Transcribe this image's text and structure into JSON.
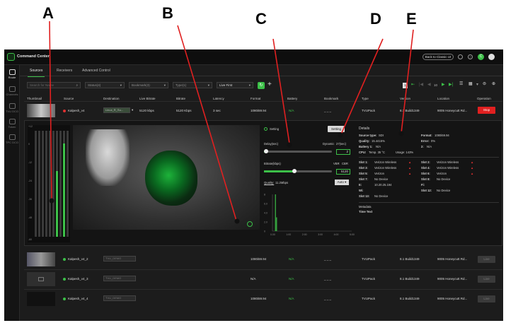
{
  "callouts": [
    "A",
    "B",
    "C",
    "D",
    "E"
  ],
  "app": {
    "title": "Command Center",
    "classic_button": "Back to Classic UI",
    "avatar_initial": "C"
  },
  "sidebar": {
    "items": [
      {
        "label": "Route",
        "icon": "route-icon"
      },
      {
        "label": "Channels",
        "icon": "channels-icon"
      },
      {
        "label": "TVU DCO",
        "icon": "tvu-dco-icon"
      },
      {
        "label": "Token",
        "icon": "token-icon"
      },
      {
        "label": "TPC DCO",
        "icon": "tpc-dco-icon"
      }
    ]
  },
  "tabs": [
    "Sources",
    "Receivers",
    "Advanced Control"
  ],
  "filters": {
    "search_placeholder": "Search for Name",
    "status": "Status(4)",
    "bookmark": "Bookmark(3)",
    "type": "Type(1)",
    "sort": "Live First"
  },
  "pagination": {
    "page": "1",
    "per_page": "10"
  },
  "columns": [
    "Thumbnail",
    "Source",
    "Destination",
    "Live Bitrate",
    "Bitrate",
    "Latency",
    "Format",
    "Battery",
    "Bookmark",
    "Type",
    "Version",
    "Location",
    "Operation"
  ],
  "rows": [
    {
      "source": "Kalpesh_v4",
      "status_color": "#e03030",
      "destination": "Linux_R_Su...",
      "live_bitrate": "5120 kbps",
      "bitrate": "5120 Kbps",
      "latency": "3 sec",
      "format": "1080i59.94",
      "battery": "N/A",
      "bookmark": "_ _ _",
      "type": "TVUPack",
      "version": "8.1 Build1349",
      "location": "9005 Honeycutt Rd...",
      "operation": "Stop"
    },
    {
      "source": "Kalpesh_v4_2",
      "status_color": "#3cc048",
      "destination": "TVU_DEMO",
      "live_bitrate": "",
      "bitrate": "",
      "latency": "",
      "format": "1080i59.94",
      "battery": "N/A",
      "bookmark": "_ _ _",
      "type": "TVUPack",
      "version": "8.1 Build1349",
      "location": "9005 Honeycutt Rd...",
      "operation": "Live"
    },
    {
      "source": "Kalpesh_v4_3",
      "status_color": "#3cc048",
      "destination": "TVU_DEMO",
      "live_bitrate": "",
      "bitrate": "",
      "latency": "",
      "format": "N/A",
      "battery": "N/A",
      "bookmark": "_ _ _",
      "type": "TVUPack",
      "version": "8.1 Build1349",
      "location": "9005 Honeycutt Rd...",
      "operation": "Live"
    },
    {
      "source": "Kalpesh_v4_4",
      "status_color": "#3cc048",
      "destination": "TVU_DEMO",
      "live_bitrate": "",
      "bitrate": "",
      "latency": "",
      "format": "1080i59.94",
      "battery": "N/A",
      "bookmark": "_ _ _",
      "type": "TVUPack",
      "version": "8.1 Build1349",
      "location": "9005 Honeycutt Rd...",
      "operation": "Live"
    }
  ],
  "audio_meter": {
    "scale": [
      "+12",
      "0",
      "-12",
      "-24",
      "-36",
      "-48",
      "-60"
    ],
    "levels": [
      0.0,
      0.0,
      0.0,
      0.0,
      0.0,
      0.0,
      0.62,
      0.0,
      0.88,
      0.0
    ]
  },
  "control": {
    "setting_label": "Setting",
    "setting_button": "Setting",
    "delay_label": "Delay(sec)",
    "dynamic_label": "Dynamic",
    "dynamic_value": "27(sec)",
    "delay_value": "2",
    "delay_level": 0.03,
    "bitrate_label": "Bitrate(kbps)",
    "vbr_label": "VBR",
    "cbr_label": "CBR",
    "bitrate_value": "5120",
    "bitrate_level": 0.45,
    "quality_label": "Quality:",
    "quality_value": "11.2Mbps",
    "auto_button": "Auto"
  },
  "mini_chart": {
    "type": "bar",
    "y_ticks": [
      "8",
      "6.0",
      "4.0",
      "2.0",
      "0"
    ],
    "x_ticks": [
      "0.00",
      "1:00",
      "2:00",
      "3:00",
      "4:00",
      "5:00"
    ],
    "values": [
      0,
      8,
      3
    ]
  },
  "details": {
    "title": "Details",
    "source_type_label": "Source type:",
    "source_type": "SDI",
    "format_label": "Format:",
    "format": "1080i59.94",
    "quality_label": "Quality:",
    "quality": "15.4415%",
    "error_label": "Error:",
    "error": "0%",
    "battery1_label": "Battery 1:",
    "battery1": "N/A",
    "battery2_label": "2:",
    "battery2": "N/A",
    "cpu_label": "CPU:",
    "cpu_temp": "Temp. 35 °C",
    "cpu_usage": "Usage: 143%",
    "slots": [
      {
        "label": "Slot 1:",
        "value": "Verizon Wireless",
        "bad": true
      },
      {
        "label": "Slot 2:",
        "value": "Verizon Wireless",
        "bad": true
      },
      {
        "label": "Slot 3:",
        "value": "Verizon Wireless",
        "bad": true
      },
      {
        "label": "Slot 4:",
        "value": "Verizon Wireless",
        "bad": true
      },
      {
        "label": "Slot 5:",
        "value": "Verizon",
        "bad": true
      },
      {
        "label": "Slot 6:",
        "value": "Verizon",
        "bad": true
      },
      {
        "label": "Slot 7:",
        "value": "No Device",
        "bad": false
      },
      {
        "label": "Slot 8:",
        "value": "No Device",
        "bad": false
      },
      {
        "label": "E:",
        "value": "10.20.25.194",
        "bad": false
      },
      {
        "label": "Fi:",
        "value": "",
        "bad": false
      },
      {
        "label": "Wi:",
        "value": "",
        "bad": false
      },
      {
        "label": "Slot 12:",
        "value": "No Device",
        "bad": false
      },
      {
        "label": "Slot 13:",
        "value": "No Device",
        "bad": false
      }
    ],
    "metadata_title": "Metadata",
    "metadata_value": "Time Text"
  },
  "colors": {
    "accent": "#3cc048",
    "danger": "#e02020",
    "bg": "#1c1c1c"
  }
}
